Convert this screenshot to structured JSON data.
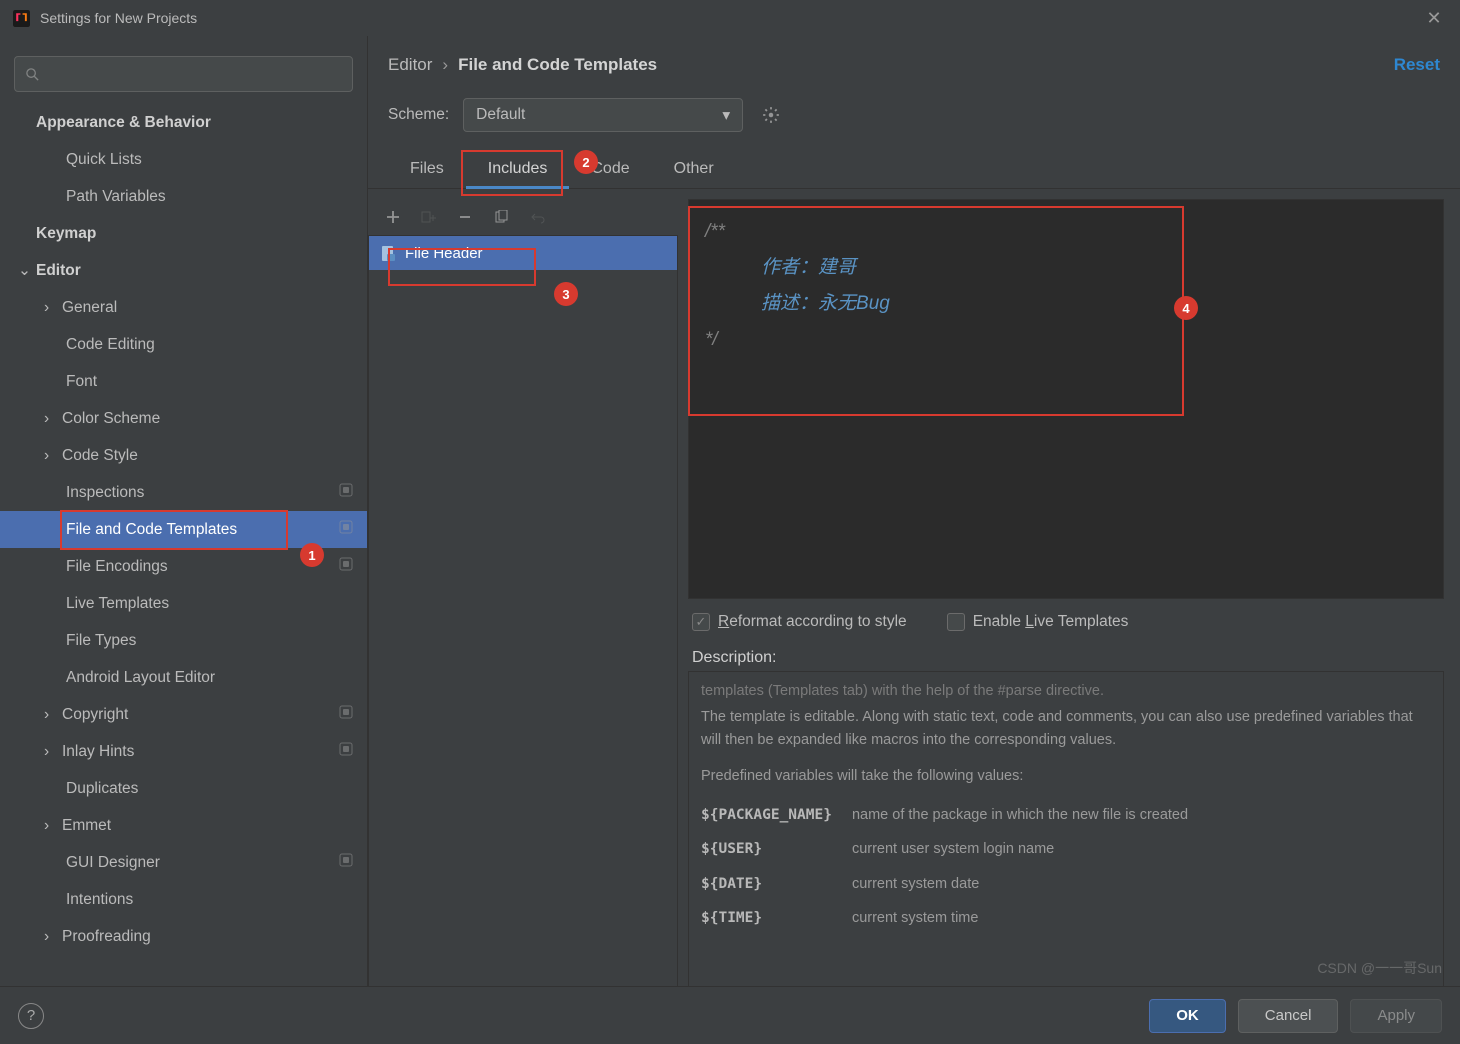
{
  "window": {
    "title": "Settings for New Projects"
  },
  "sidebar": {
    "items": [
      {
        "label": "Appearance & Behavior",
        "bold": true,
        "level": 0
      },
      {
        "label": "Quick Lists",
        "level": 2
      },
      {
        "label": "Path Variables",
        "level": 2
      },
      {
        "label": "Keymap",
        "bold": true,
        "level": 0
      },
      {
        "label": "Editor",
        "bold": true,
        "level": 0,
        "expanded": true
      },
      {
        "label": "General",
        "level": 1,
        "chev": true
      },
      {
        "label": "Code Editing",
        "level": 2
      },
      {
        "label": "Font",
        "level": 2
      },
      {
        "label": "Color Scheme",
        "level": 1,
        "chev": true
      },
      {
        "label": "Code Style",
        "level": 1,
        "chev": true
      },
      {
        "label": "Inspections",
        "level": 2,
        "trail": true
      },
      {
        "label": "File and Code Templates",
        "level": 2,
        "selected": true,
        "trail": true
      },
      {
        "label": "File Encodings",
        "level": 2,
        "trail": true
      },
      {
        "label": "Live Templates",
        "level": 2
      },
      {
        "label": "File Types",
        "level": 2
      },
      {
        "label": "Android Layout Editor",
        "level": 2
      },
      {
        "label": "Copyright",
        "level": 1,
        "chev": true,
        "trail": true
      },
      {
        "label": "Inlay Hints",
        "level": 1,
        "chev": true,
        "trail": true
      },
      {
        "label": "Duplicates",
        "level": 2
      },
      {
        "label": "Emmet",
        "level": 1,
        "chev": true
      },
      {
        "label": "GUI Designer",
        "level": 2,
        "trail": true
      },
      {
        "label": "Intentions",
        "level": 2
      },
      {
        "label": "Proofreading",
        "level": 1,
        "chev": true
      }
    ]
  },
  "breadcrumb": {
    "parent": "Editor",
    "current": "File and Code Templates",
    "reset": "Reset"
  },
  "scheme": {
    "label": "Scheme:",
    "value": "Default"
  },
  "tabs": [
    "Files",
    "Includes",
    "Code",
    "Other"
  ],
  "active_tab": 1,
  "templates": {
    "items": [
      {
        "label": "File Header",
        "selected": true
      }
    ]
  },
  "editor_code": {
    "l1": "/**",
    "l2_k": "作者：",
    "l2_v": "建哥",
    "l3_k": "描述：",
    "l3_v": "永无Bug",
    "l4": "*/"
  },
  "options": {
    "reformat": "Reformat according to style",
    "enable_live": "Enable Live Templates",
    "r_hot": "R",
    "l_hot": "L"
  },
  "description": {
    "heading": "Description:",
    "cutline": "templates (Templates tab) with the help of the #parse directive.",
    "para": "The template is editable. Along with static text, code and comments, you can also use predefined variables that will then be expanded like macros into the corresponding values.",
    "predef": "Predefined variables will take the following values:",
    "vars": [
      {
        "name": "${PACKAGE_NAME}",
        "desc": "name of the package in which the new file is created"
      },
      {
        "name": "${USER}",
        "desc": "current user system login name"
      },
      {
        "name": "${DATE}",
        "desc": "current system date"
      },
      {
        "name": "${TIME}",
        "desc": "current system time"
      }
    ]
  },
  "buttons": {
    "ok": "OK",
    "cancel": "Cancel",
    "apply": "Apply"
  },
  "watermark": "CSDN @一一哥Sun",
  "annotations": {
    "1": "1",
    "2": "2",
    "3": "3",
    "4": "4"
  }
}
